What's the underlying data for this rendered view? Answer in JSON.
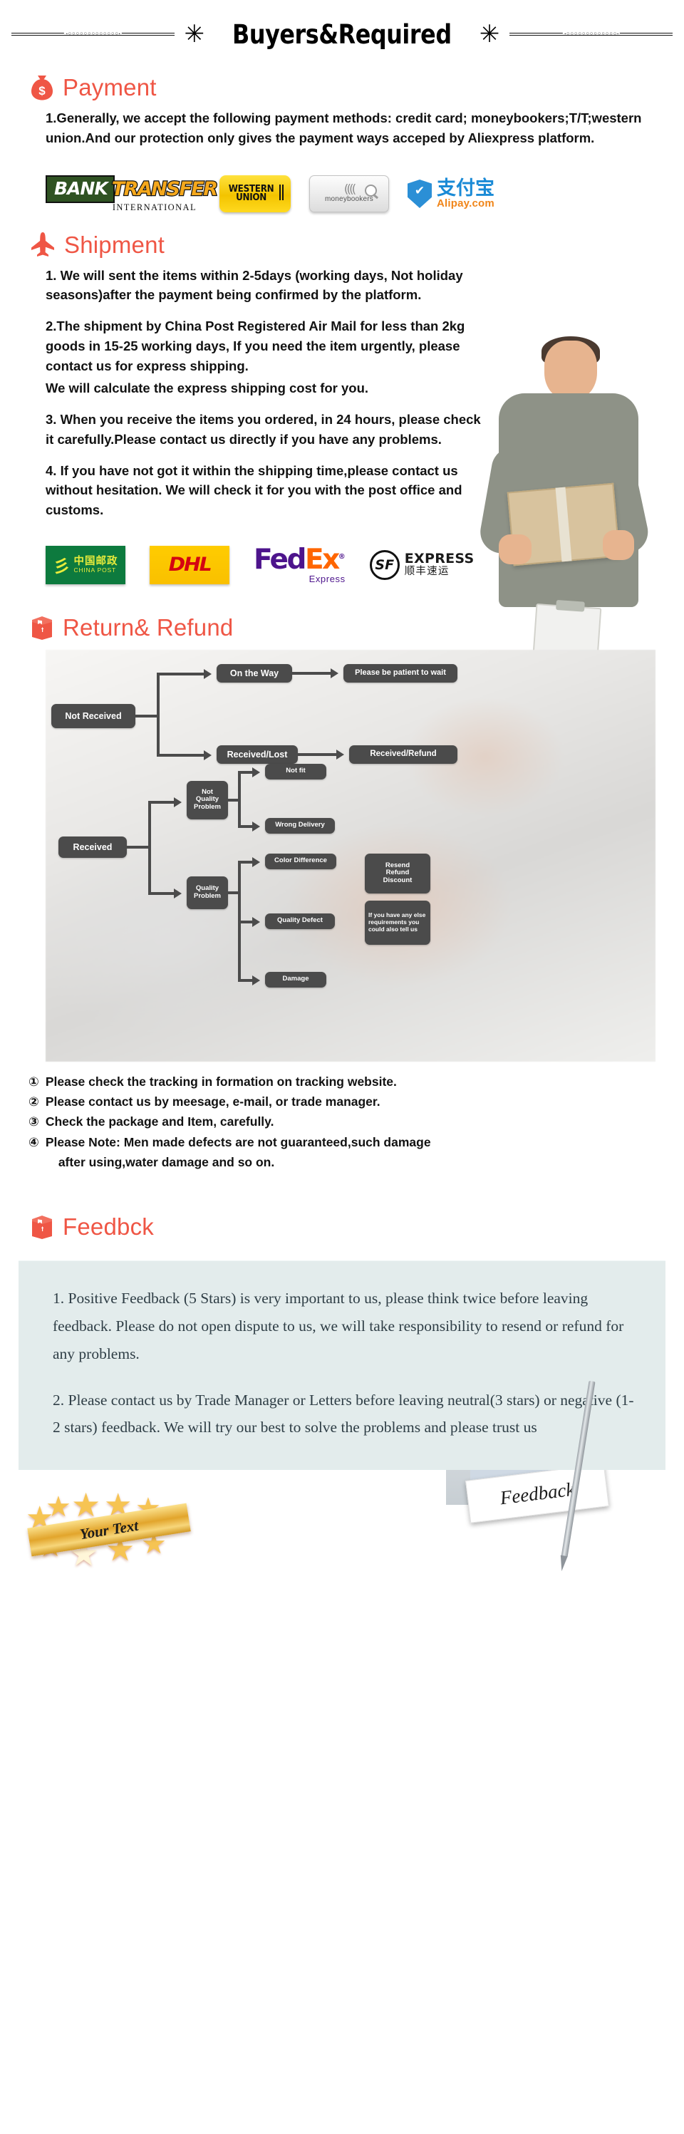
{
  "banner": {
    "title": "Buyers&Required",
    "star_glyph": "✳",
    "bead_glyph": "·◦◦◦◦◦◦◦◦◦◦◦◦◦·"
  },
  "sections": {
    "payment": {
      "heading": "Payment",
      "icon": "money-bag-icon",
      "paragraphs": [
        "1.Generally, we accept the following payment methods: credit card; moneybookers;T/T;western union.And our protection only gives the payment ways acceped by Aliexpress platform."
      ],
      "logos": [
        {
          "name": "bank-transfer-logo",
          "primary": "BANK",
          "secondary": "TRANSFER",
          "sub": "INTERNATIONAL"
        },
        {
          "name": "western-union-logo",
          "line1": "WESTERN",
          "line2": "UNION"
        },
        {
          "name": "moneybookers-logo",
          "label": "moneybookers",
          "waves": "(((("
        },
        {
          "name": "alipay-logo",
          "cn": "支付宝",
          "en": "Alipay.com"
        }
      ]
    },
    "shipment": {
      "heading": "Shipment",
      "icon": "airplane-icon",
      "paragraphs": [
        "1. We will sent the items within 2-5days (working days, Not holiday seasons)after the payment being confirmed by the platform.",
        "2.The shipment by China Post Registered Air Mail for less than  2kg goods in 15-25 working days, If  you need the item urgently, please contact us for express shipping.",
        "We will calculate the express shipping cost for you.",
        "3. When you receive the items you ordered, in 24 hours, please check it carefully.Please contact us directly if you have any problems.",
        "4. If you have not got it within the shipping time,please contact us without hesitation. We will check it for you with the post office and customs."
      ],
      "logos": [
        {
          "name": "china-post-logo",
          "cn": "中国邮政",
          "en": "CHINA POST"
        },
        {
          "name": "dhl-logo",
          "label": "DHL"
        },
        {
          "name": "fedex-logo",
          "fed": "Fed",
          "ex": "Ex",
          "reg": "®",
          "sub": "Express"
        },
        {
          "name": "sf-express-logo",
          "circle": "SF",
          "en": "EXPRESS",
          "cn": "顺丰速运"
        }
      ]
    },
    "return_refund": {
      "heading": "Return& Refund",
      "icon": "package-icon",
      "flow": {
        "not_received": "Not Received",
        "on_the_way": "On the Way",
        "be_patient": "Please be patient to wait",
        "received_lost": "Received/Lost",
        "received_refund": "Received/Refund",
        "received": "Received",
        "not_quality_problem": "Not\nQuality\nProblem",
        "quality_problem": "Quality\nProblem",
        "not_fit": "Not fit",
        "wrong_delivery": "Wrong Delivery",
        "color_difference": "Color Difference",
        "quality_defect": "Quality Defect",
        "damage": "Damage",
        "resend_refund_discount": "Resend\nRefund\nDiscount",
        "else_requirements": "If you have any else\nrequirements you\ncould also tell us"
      },
      "notes": [
        {
          "num": "①",
          "text": "Please check the tracking in formation on tracking website."
        },
        {
          "num": "②",
          "text": "Please contact us by meesage, e-mail, or trade manager."
        },
        {
          "num": "③",
          "text": "Check the package and Item, carefully."
        },
        {
          "num": "④",
          "text": "Please Note: Men made defects  are not guaranteed,such damage",
          "text2": "after using,water damage and so on."
        }
      ]
    },
    "feedback": {
      "heading": "Feedbck",
      "icon": "package-icon",
      "card_label": "Feedback",
      "paragraphs": [
        "1. Positive Feedback (5 Stars) is very important to us, please think twice before leaving feedback. Please do not open dispute to us,   we will take responsibility to resend or refund for any problems.",
        "2. Please contact us by Trade Manager or Letters before leaving neutral(3 stars) or negative (1-2 stars) feedback. We will try our best to solve the problems and please trust us"
      ]
    }
  },
  "badge": {
    "label": "Your Text",
    "star_glyph": "★"
  },
  "colors": {
    "accent": "#ef5645",
    "node": "#4b4b4b",
    "feedback_bg": "#e3ecec",
    "fedex_purple": "#4d148c",
    "fedex_orange": "#ff6600",
    "dhl_yellow": "#ffcc00",
    "dhl_red": "#d40511",
    "china_post_green": "#0d7a3e"
  }
}
